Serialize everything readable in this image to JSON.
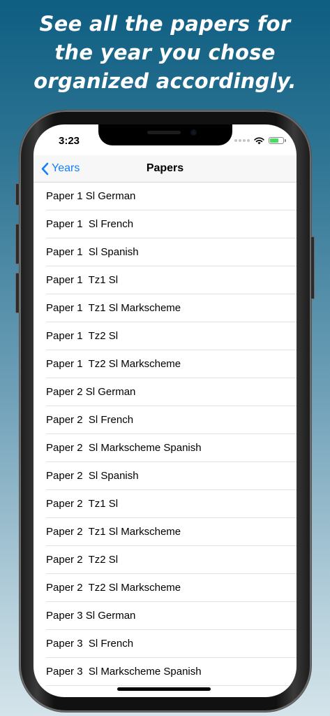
{
  "headline": {
    "line1": "See all the papers for",
    "line2": "the year you chose",
    "line3": "organized accordingly."
  },
  "status_bar": {
    "time": "3:23",
    "signal_icon": "signal-dots-icon",
    "wifi_icon": "wifi-icon",
    "battery_icon": "battery-charging-icon",
    "battery_level": 0.7
  },
  "nav": {
    "back_label": "Years",
    "back_icon": "chevron-left-icon",
    "title": "Papers"
  },
  "papers": [
    "Paper 1 Sl German",
    "Paper 1  Sl French",
    "Paper 1  Sl Spanish",
    "Paper 1  Tz1 Sl",
    "Paper 1  Tz1 Sl Markscheme",
    "Paper 1  Tz2 Sl",
    "Paper 1  Tz2 Sl Markscheme",
    "Paper 2 Sl German",
    "Paper 2  Sl French",
    "Paper 2  Sl Markscheme Spanish",
    "Paper 2  Sl Spanish",
    "Paper 2  Tz1 Sl",
    "Paper 2  Tz1 Sl Markscheme",
    "Paper 2  Tz2 Sl",
    "Paper 2  Tz2 Sl Markscheme",
    "Paper 3 Sl German",
    "Paper 3  Sl French",
    "Paper 3  Sl Markscheme Spanish"
  ],
  "colors": {
    "accent": "#147efb",
    "battery": "#4cd964",
    "background_top": "#0e5e82",
    "background_bottom": "#d4e4ea"
  }
}
